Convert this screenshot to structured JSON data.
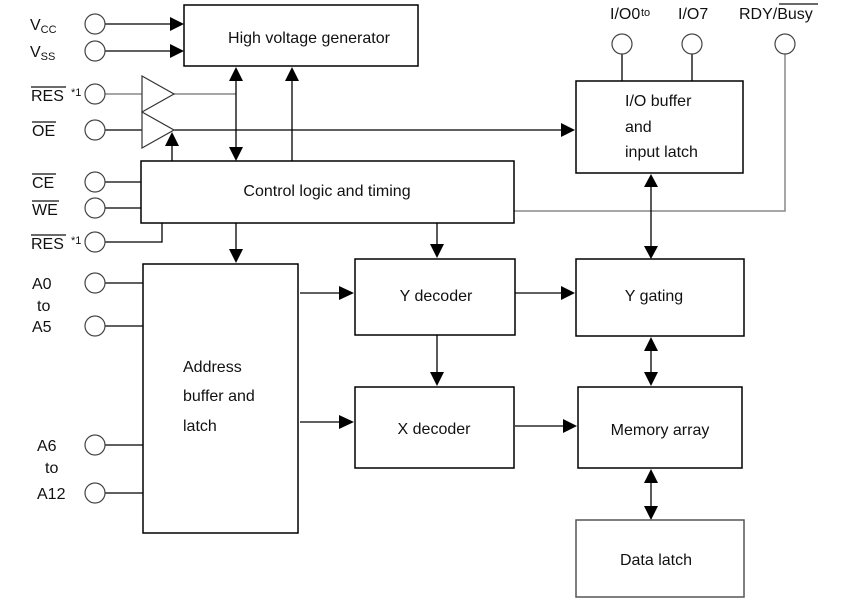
{
  "diagram": {
    "blocks": {
      "hv_generator": "High voltage generator",
      "control_logic": "Control logic and timing",
      "io_buffer": [
        "I/O buffer",
        "and",
        "input latch"
      ],
      "address_buffer": [
        "Address",
        "buffer and",
        "latch"
      ],
      "y_decoder": "Y decoder",
      "x_decoder": "X decoder",
      "y_gating": "Y gating",
      "memory_array": "Memory array",
      "data_latch": "Data latch"
    },
    "pins": {
      "vcc": {
        "main": "V",
        "sub": "CC"
      },
      "vss": {
        "main": "V",
        "sub": "SS"
      },
      "res_top": {
        "label": "RES",
        "note": "*1",
        "active_low": true
      },
      "oe": {
        "label": "OE",
        "active_low": true
      },
      "ce": {
        "label": "CE",
        "active_low": true
      },
      "we": {
        "label": "WE",
        "active_low": true
      },
      "res_bottom": {
        "label": "RES",
        "note": "*1",
        "active_low": true
      },
      "a0": "A0",
      "a0_to": "to",
      "a5": "A5",
      "a6": "A6",
      "a6_to": "to",
      "a12": "A12",
      "io0": "I/O0",
      "io_to": "to",
      "io7": "I/O7",
      "rdy": "RDY/",
      "busy": {
        "label": "Busy",
        "active_low": true
      }
    }
  }
}
